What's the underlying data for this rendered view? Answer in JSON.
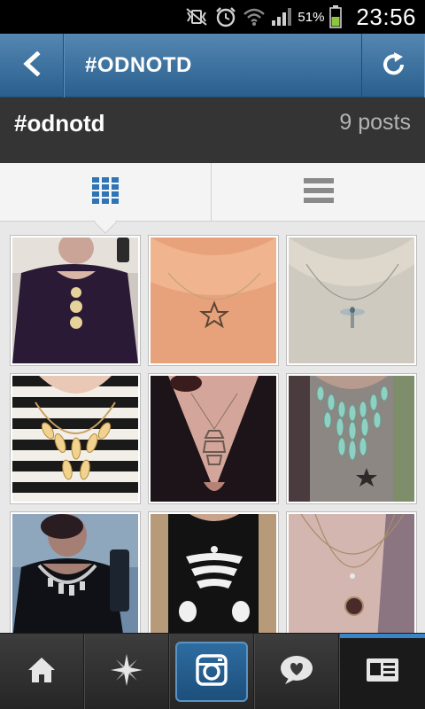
{
  "status_bar": {
    "battery_percent": "51%",
    "time": "23:56",
    "icons": [
      "mute-vibrate-icon",
      "alarm-icon",
      "wifi-icon",
      "signal-icon",
      "battery-icon"
    ]
  },
  "action_bar": {
    "title": "#ODNOTD",
    "back_icon": "chevron-left-icon",
    "refresh_icon": "refresh-icon"
  },
  "hashtag": {
    "name": "#odnotd",
    "post_count": "9 posts"
  },
  "view_toggle": {
    "selected": "grid",
    "options": [
      "grid-view-icon",
      "list-view-icon"
    ]
  },
  "photos": [
    {
      "subject": "woman in black dress with gold disc necklace"
    },
    {
      "subject": "star pendant necklace"
    },
    {
      "subject": "dragonfly pendant necklace"
    },
    {
      "subject": "statement necklace on striped top"
    },
    {
      "subject": "pendant on black v-neck"
    },
    {
      "subject": "mint crystal bib necklace"
    },
    {
      "subject": "silver statement necklace"
    },
    {
      "subject": "ribcage print necklace"
    },
    {
      "subject": "layered round pendant necklace"
    }
  ],
  "bottom_nav": {
    "items": [
      "home-icon",
      "explore-icon",
      "camera-icon",
      "news-icon",
      "profile-icon"
    ],
    "active": "profile-icon"
  },
  "colors": {
    "actionbar": "#3a6f9e",
    "header_bg": "#343434",
    "accent": "#2f74b4"
  }
}
